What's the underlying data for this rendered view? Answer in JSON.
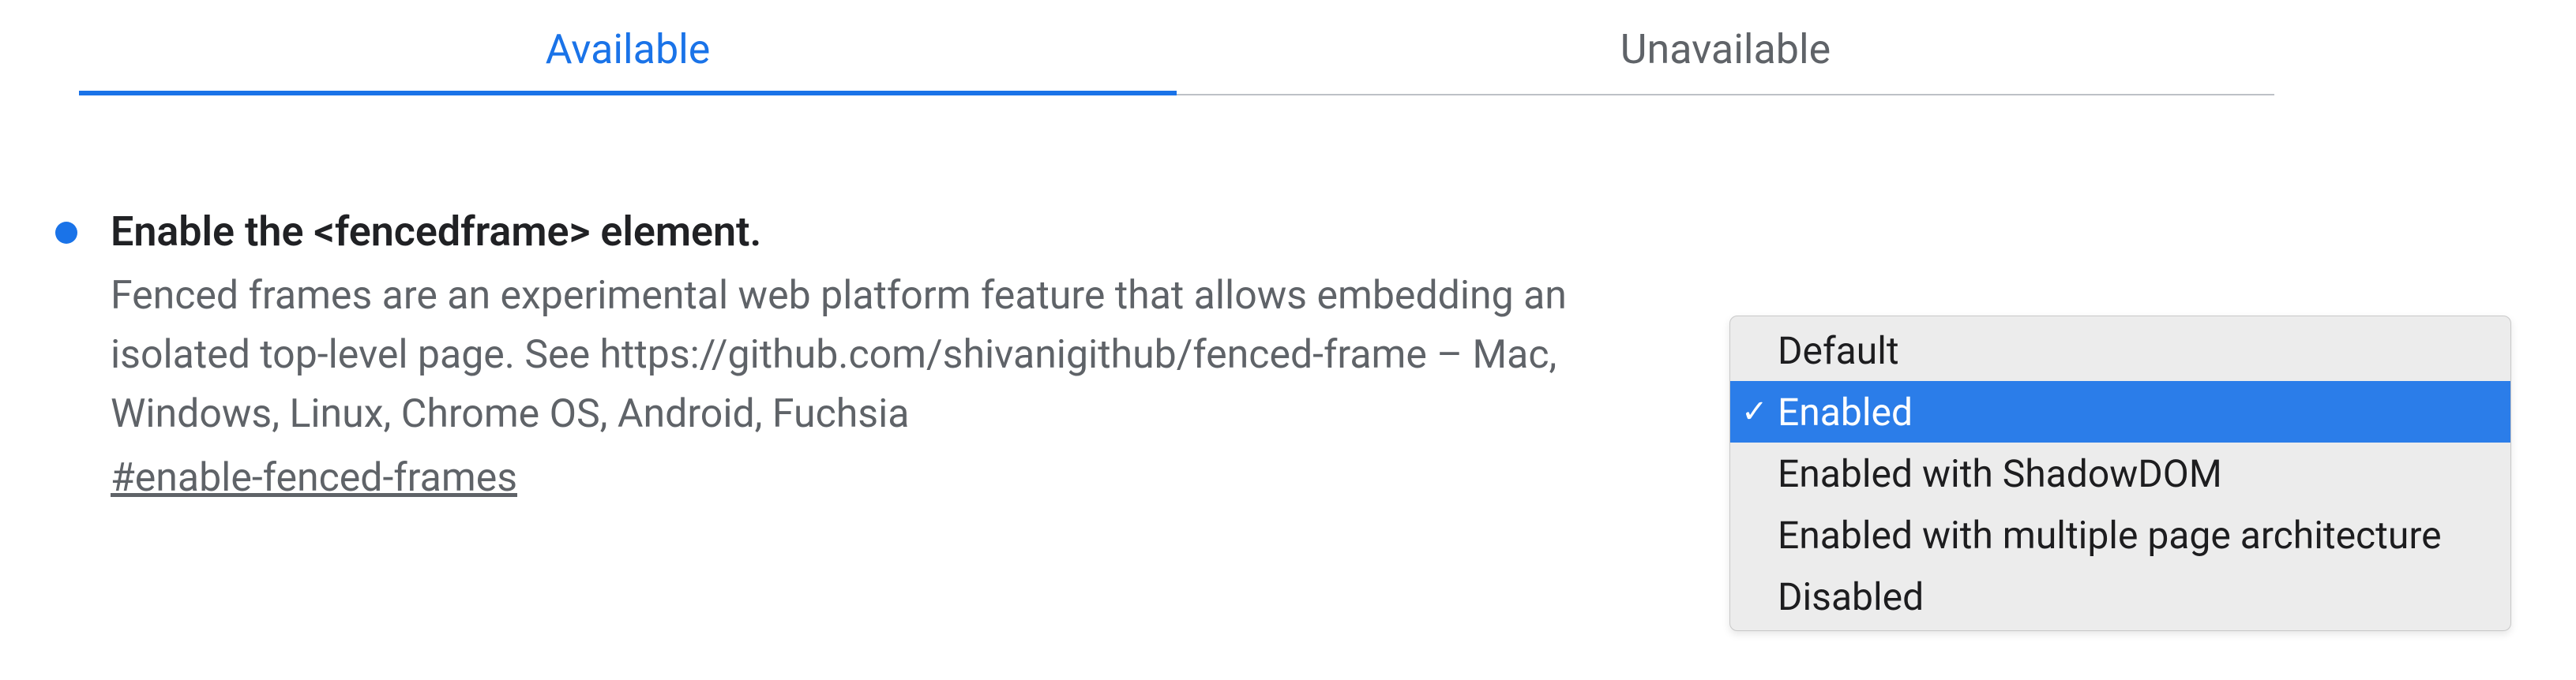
{
  "tabs": {
    "available": "Available",
    "unavailable": "Unavailable"
  },
  "flag": {
    "title": "Enable the <fencedframe> element.",
    "description": "Fenced frames are an experimental web platform feature that allows embedding an isolated top-level page. See https://github.com/shivanigithub/fenced-frame – Mac, Windows, Linux, Chrome OS, Android, Fuchsia",
    "hash": "#enable-fenced-frames",
    "status_color": "#1a73e8"
  },
  "dropdown": {
    "options": [
      "Default",
      "Enabled",
      "Enabled with ShadowDOM",
      "Enabled with multiple page architecture",
      "Disabled"
    ],
    "selected_index": 1
  }
}
